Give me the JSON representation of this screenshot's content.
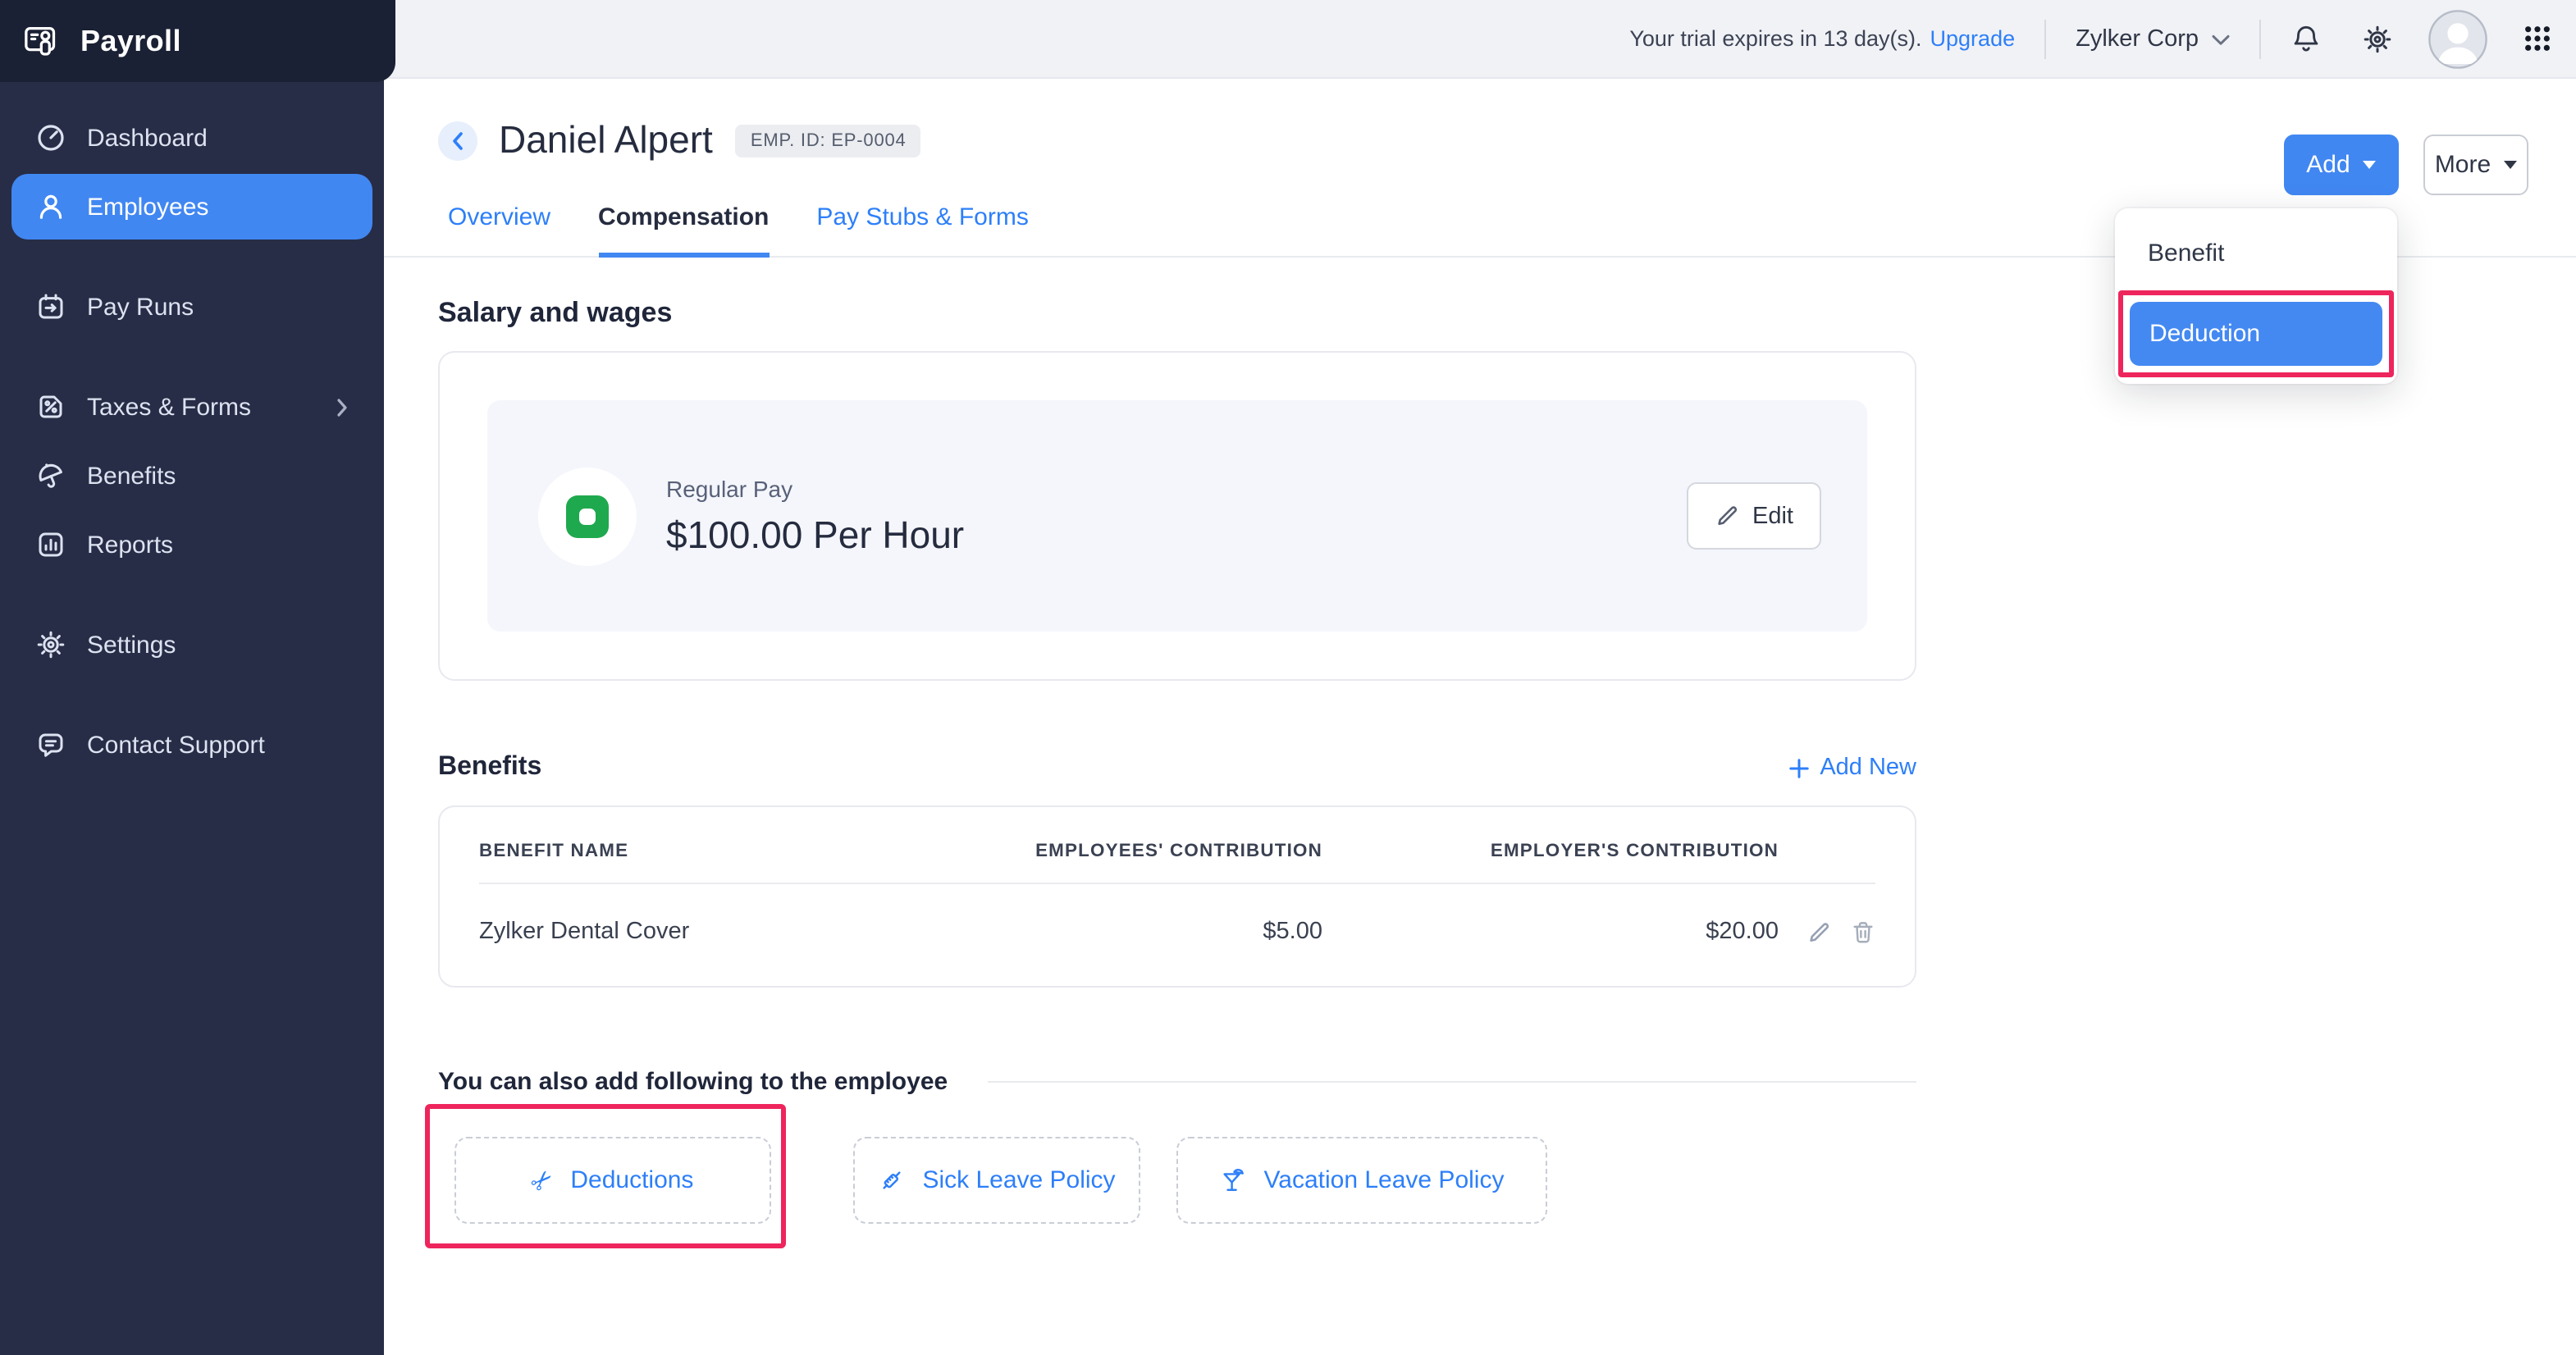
{
  "app": {
    "name": "Payroll"
  },
  "topbar": {
    "trial_text": "Your trial expires in 13 day(s).",
    "upgrade_label": "Upgrade",
    "org_name": "Zylker Corp"
  },
  "sidebar": {
    "items": [
      {
        "label": "Dashboard",
        "icon": "dashboard-icon",
        "active": false
      },
      {
        "label": "Employees",
        "icon": "employees-icon",
        "active": true
      },
      {
        "label": "Pay Runs",
        "icon": "pay-runs-icon",
        "active": false
      },
      {
        "label": "Taxes & Forms",
        "icon": "taxes-forms-icon",
        "active": false,
        "has_submenu": true
      },
      {
        "label": "Benefits",
        "icon": "umbrella-icon",
        "active": false
      },
      {
        "label": "Reports",
        "icon": "reports-icon",
        "active": false
      },
      {
        "label": "Settings",
        "icon": "gear-icon",
        "active": false
      },
      {
        "label": "Contact Support",
        "icon": "chat-bubble-icon",
        "active": false
      }
    ]
  },
  "header": {
    "employee_name": "Daniel Alpert",
    "employee_id_badge": "EMP. ID: EP-0004",
    "add_button": "Add",
    "more_button": "More",
    "tabs": [
      {
        "label": "Overview",
        "active": false
      },
      {
        "label": "Compensation",
        "active": true
      },
      {
        "label": "Pay Stubs & Forms",
        "active": false
      }
    ]
  },
  "add_menu": {
    "items": [
      {
        "label": "Benefit",
        "selected": false
      },
      {
        "label": "Deduction",
        "selected": true,
        "annotated": true
      }
    ]
  },
  "salary": {
    "section_title": "Salary and wages",
    "pay_type": "Regular Pay",
    "pay_rate": "$100.00 Per Hour",
    "edit_button": "Edit"
  },
  "benefits": {
    "section_title": "Benefits",
    "add_new_label": "Add New",
    "table": {
      "columns": [
        "BENEFIT NAME",
        "EMPLOYEES' CONTRIBUTION",
        "EMPLOYER'S CONTRIBUTION"
      ],
      "rows": [
        {
          "benefit_name": "Zylker Dental Cover",
          "employees_contribution": "$5.00",
          "employers_contribution": "$20.00"
        }
      ]
    }
  },
  "suggestions": {
    "title": "You can also add following to the employee",
    "items": [
      {
        "label": "Deductions",
        "icon": "scissors-icon",
        "annotated": true
      },
      {
        "label": "Sick Leave Policy",
        "icon": "syringe-icon",
        "annotated": false
      },
      {
        "label": "Vacation Leave Policy",
        "icon": "cocktail-icon",
        "annotated": false
      }
    ]
  },
  "colors": {
    "accent_blue": "#2d7ff9",
    "button_blue": "#4187f2",
    "annotation_red": "#ee255c",
    "sidebar_bg": "#272d46",
    "sidebar_logo_bg": "#1b2134",
    "topbar_bg": "#f1f2f6",
    "money_green": "#1fa94e"
  }
}
